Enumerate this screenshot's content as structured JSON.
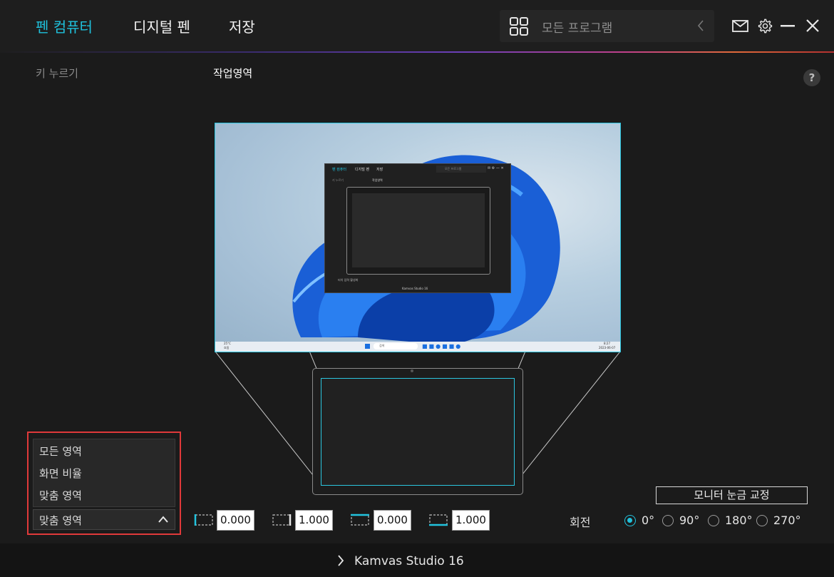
{
  "header": {
    "tabs": [
      {
        "label": "펜 컴퓨터",
        "active": true
      },
      {
        "label": "디지털 펜",
        "active": false
      },
      {
        "label": "저장",
        "active": false
      }
    ],
    "search_placeholder": "모든 프로그램"
  },
  "subtabs": {
    "key_press": "키 누르기",
    "work_area": "작업영역"
  },
  "help_label": "?",
  "area_mode": {
    "options": [
      "모든 영역",
      "화면 비율",
      "맞춤 영역"
    ],
    "selected": "맞춤 영역"
  },
  "coords": [
    "0.000",
    "1.000",
    "0.000",
    "1.000"
  ],
  "calibrate_label": "모니터 눈금 교정",
  "rotation": {
    "label": "회전",
    "options": [
      "0°",
      "90°",
      "180°",
      "270°"
    ],
    "selected": "0°"
  },
  "preview_window": {
    "tabs": [
      "펜 컴퓨터",
      "디지털 펜",
      "저장"
    ],
    "search_placeholder": "모든 프로그램",
    "subtabs": [
      "키 누르기",
      "작업영역"
    ],
    "checkbox_label": "터치 입력 활성화",
    "device": "Kamvas Studio 16"
  },
  "taskbar": {
    "search": "검색",
    "weather": "25°C",
    "weather_status": "흐림",
    "time": "8:27",
    "date": "2023-06-07"
  },
  "device_name": "Kamvas Studio 16",
  "colors": {
    "accent": "#1fc1dc",
    "highlight": "#e0393a"
  }
}
